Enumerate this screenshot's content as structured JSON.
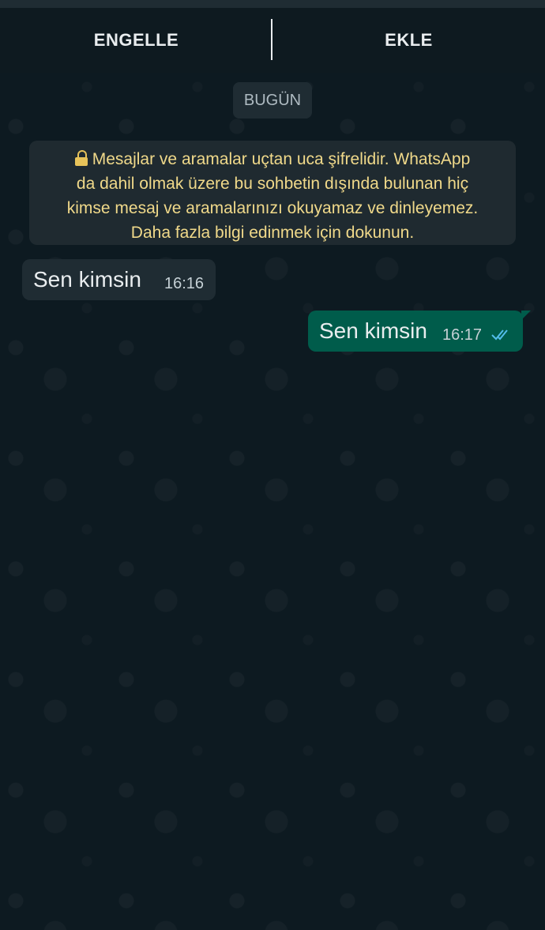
{
  "action_bar": {
    "block_label": "ENGELLE",
    "add_label": "EKLE"
  },
  "date_chip": "BUGÜN",
  "encryption_notice": {
    "line1": "Mesajlar ve aramalar uçtan uca şifrelidir. WhatsApp",
    "line2": "da dahil olmak üzere bu sohbetin dışında bulunan hiç",
    "line3": "kimse mesaj ve aramalarınızı okuyamaz ve dinleyemez.",
    "line4": "Daha fazla bilgi edinmek için dokunun."
  },
  "messages": [
    {
      "direction": "incoming",
      "text": "Sen kimsin",
      "time": "16:16"
    },
    {
      "direction": "outgoing",
      "text": "Sen kimsin",
      "time": "16:17",
      "status": "read"
    }
  ],
  "colors": {
    "background": "#0d1a21",
    "incoming_bubble": "#1f2c33",
    "outgoing_bubble": "#005c4b",
    "notice_text": "#f0d98a",
    "read_ticks": "#53bdeb"
  },
  "icons": {
    "lock": "lock-icon",
    "read_receipt": "double-check-icon"
  }
}
